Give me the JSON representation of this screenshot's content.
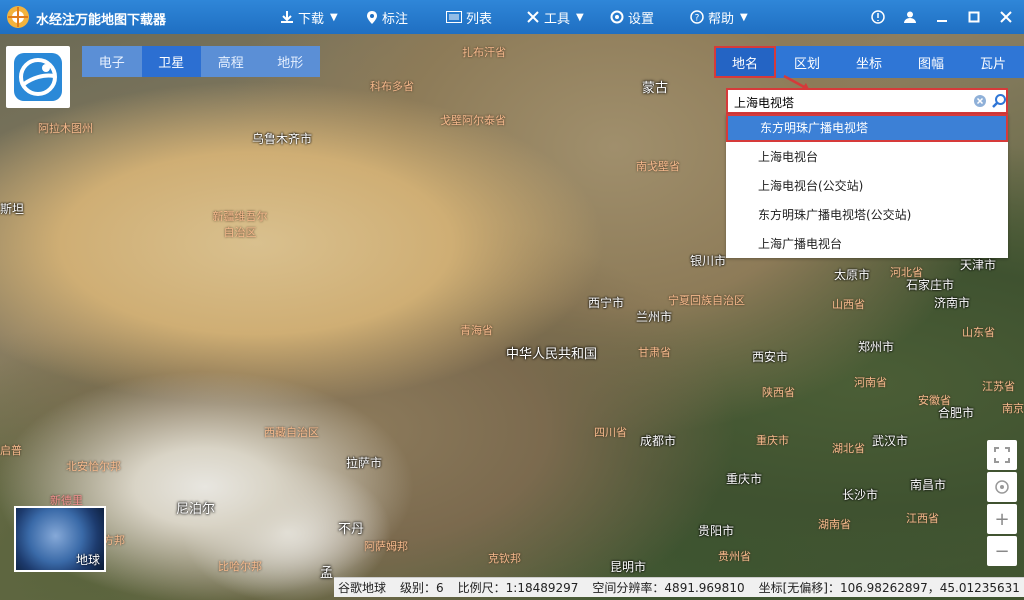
{
  "app": {
    "title": "水经注万能地图下载器"
  },
  "toolbar": {
    "download": "下载",
    "annotate": "标注",
    "list": "列表",
    "tools": "工具",
    "settings": "设置",
    "help": "帮助"
  },
  "map_types": [
    "电子",
    "卫星",
    "高程",
    "地形"
  ],
  "map_type_active": "卫星",
  "panel": {
    "tabs": [
      "地名",
      "区划",
      "坐标",
      "图幅",
      "瓦片"
    ],
    "active_tab": "地名",
    "search_value": "上海电视塔",
    "results": [
      "东方明珠广播电视塔",
      "上海电视台",
      "上海电视台(公交站)",
      "东方明珠广播电视塔(公交站)",
      "上海广播电视台"
    ],
    "selected_index": 0
  },
  "map_labels": {
    "countries": [
      "蒙古",
      "中华人民共和国",
      "尼泊尔",
      "不丹",
      "孟"
    ],
    "cities": [
      "乌鲁木齐市",
      "西宁市",
      "兰州市",
      "银川市",
      "太原市",
      "石家庄市",
      "济南市",
      "天津市",
      "郑州市",
      "西安市",
      "合肥市",
      "武汉市",
      "成都市",
      "重庆市",
      "长沙市",
      "南昌市",
      "贵阳市",
      "昆明市",
      "拉萨市"
    ],
    "provinces": [
      "阿拉木图州",
      "科布多省",
      "戈壁阿尔泰省",
      "南戈壁省",
      "扎布汗省",
      "新疆维吾尔自治区",
      "宁夏回族自治区",
      "青海省",
      "甘肃省",
      "陕西省",
      "河南省",
      "山西省",
      "河北省",
      "山东省",
      "江苏省",
      "安徽省",
      "湖北省",
      "重庆市",
      "四川省",
      "西藏自治区",
      "湖南省",
      "江西省",
      "贵州省",
      "北方邦",
      "北安恰尔邦",
      "比哈尔邦",
      "阿萨姆邦",
      "克钦邦",
      "新德里",
      "斯坦",
      "启普",
      "南京"
    ]
  },
  "globe_label": "地球",
  "status": {
    "source": "谷歌地球",
    "level": "级别：6",
    "scale": "比例尺：1:18489297",
    "resolution": "空间分辨率：4891.969810",
    "coords": "坐标[无偏移]：106.98262897，45.01235631"
  },
  "colors": {
    "titlebar": "#1f6fc2",
    "tab_active": "#2464c4",
    "highlight": "#d63a3a"
  }
}
